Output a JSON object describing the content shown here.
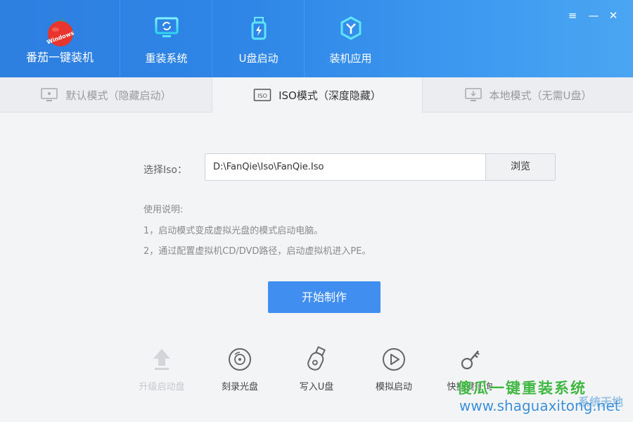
{
  "header": {
    "brand": "番茄一键装机",
    "logo_text": "Windows",
    "nav": [
      {
        "label": "重装系统",
        "icon": "monitor-refresh-icon"
      },
      {
        "label": "U盘启动",
        "icon": "usb-drive-icon"
      },
      {
        "label": "装机应用",
        "icon": "app-shield-icon"
      }
    ],
    "window_controls": [
      "≡",
      "—",
      "✕"
    ]
  },
  "tabs": [
    {
      "label": "默认模式（隐藏启动）",
      "icon": "monitor-icon",
      "active": false
    },
    {
      "label": "ISO模式（深度隐藏）",
      "icon": "iso-icon",
      "icon_text": "ISO",
      "active": true
    },
    {
      "label": "本地模式（无需U盘）",
      "icon": "monitor-download-icon",
      "active": false
    }
  ],
  "iso": {
    "label": "选择Iso：",
    "path": "D:\\FanQie\\Iso\\FanQie.Iso",
    "browse_label": "浏览"
  },
  "instructions": {
    "title": "使用说明:",
    "line1": "1，启动模式变成虚拟光盘的模式启动电脑。",
    "line2": "2，通过配置虚拟机CD/DVD路径，启动虚拟机进入PE。"
  },
  "start_label": "开始制作",
  "tools": [
    {
      "label": "升级启动盘",
      "icon": "upload-arrow-icon",
      "enabled": false
    },
    {
      "label": "刻录光盘",
      "icon": "disc-icon",
      "enabled": true
    },
    {
      "label": "写入U盘",
      "icon": "usb-write-icon",
      "enabled": true
    },
    {
      "label": "模拟启动",
      "icon": "play-circle-icon",
      "enabled": true
    },
    {
      "label": "快捷键查询",
      "icon": "key-icon",
      "enabled": true
    }
  ],
  "watermark": {
    "line1": "傻瓜一键重装系统",
    "line2": "www.shaguaxitong.net",
    "line3": "系统天地"
  },
  "colors": {
    "header_blue": "#2f86e6",
    "primary_button": "#3f8ef0",
    "watermark_green": "#3fb642",
    "watermark_blue": "#3a8ed8"
  }
}
